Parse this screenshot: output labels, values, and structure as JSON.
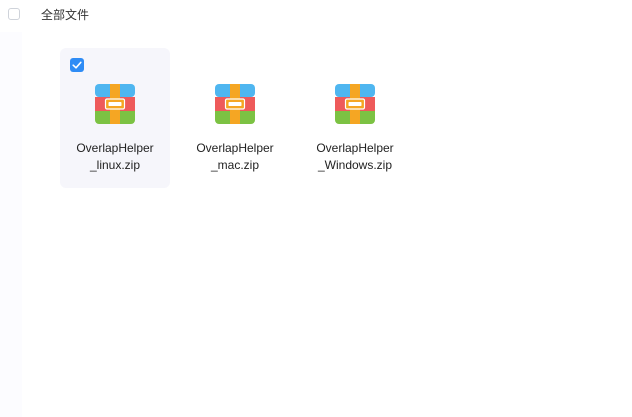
{
  "header": {
    "breadcrumb": "全部文件"
  },
  "files": [
    {
      "name_line1": "OverlapHelper",
      "name_line2": "_linux.zip",
      "selected": true,
      "icon": "zip-archive-icon"
    },
    {
      "name_line1": "OverlapHelper",
      "name_line2": "_mac.zip",
      "selected": false,
      "icon": "zip-archive-icon"
    },
    {
      "name_line1": "OverlapHelper",
      "name_line2": "_Windows.zip",
      "selected": false,
      "icon": "zip-archive-icon"
    }
  ],
  "colors": {
    "selection_bg": "#f6f6fb",
    "check_blue": "#2f8cf5",
    "zip_blue": "#4fb6f0",
    "zip_red": "#ee5a5a",
    "zip_green": "#7cc243",
    "zip_orange": "#f5a623"
  }
}
